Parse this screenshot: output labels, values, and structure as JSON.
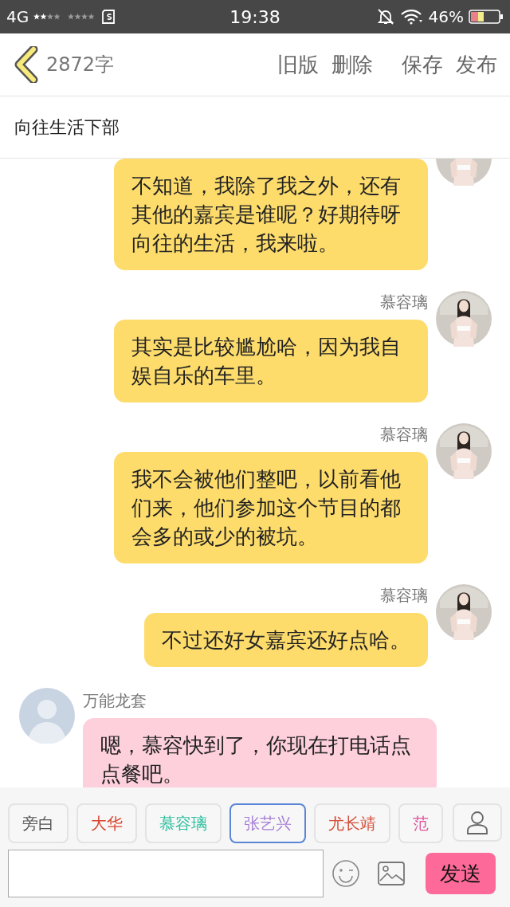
{
  "status_bar": {
    "network": "4G",
    "time": "19:38",
    "battery": "46%"
  },
  "header": {
    "word_count": "2872字",
    "actions": [
      "旧版",
      "删除",
      "保存",
      "发布"
    ]
  },
  "title": "向往生活下部",
  "messages": [
    {
      "kind": "right",
      "color": "#fddc6c",
      "text": "不知道，我除了我之外，还有其他的嘉宾是谁呢？好期待呀向往的生活，我来啦。"
    },
    {
      "kind": "right",
      "name": "慕容璃",
      "color": "#fddc6c",
      "text": "其实是比较尴尬哈，因为我自娱自乐的车里。"
    },
    {
      "kind": "right",
      "name": "慕容璃",
      "color": "#fddc6c",
      "text": "我不会被他们整吧，以前看他们来，他们参加这个节目的都会多的或少的被坑。"
    },
    {
      "kind": "right",
      "name": "慕容璃",
      "color": "#fddc6c",
      "text": "不过还好女嘉宾还好点哈。"
    },
    {
      "kind": "left",
      "name": "万能龙套",
      "color": "#fdd0dc",
      "text": "嗯，慕容快到了，你现在打电话点点餐吧。"
    }
  ],
  "roles": [
    {
      "label": "旁白",
      "color": "#555555",
      "selected": false
    },
    {
      "label": "大华",
      "color": "#d9452f",
      "selected": false
    },
    {
      "label": "慕容璃",
      "color": "#2fbf9f",
      "selected": false
    },
    {
      "label": "张艺兴",
      "color": "#a77fd6",
      "selected": true
    },
    {
      "label": "尤长靖",
      "color": "#d64f3a",
      "selected": false
    },
    {
      "label": "范",
      "color": "#e0559e",
      "selected": false
    }
  ],
  "composer": {
    "send": "发送"
  }
}
